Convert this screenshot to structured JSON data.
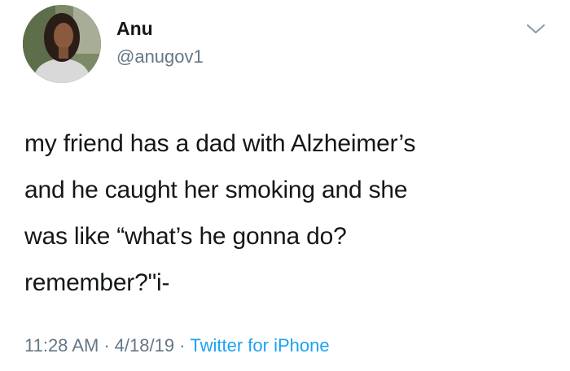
{
  "user": {
    "display_name": "Anu",
    "handle": "@anugov1"
  },
  "tweet": {
    "lines": [
      "my friend has a dad with Alzheimer’s",
      "and he caught her smoking and she",
      "was like “what’s he gonna do?",
      "remember?\"i-"
    ]
  },
  "meta": {
    "time": "11:28 AM",
    "separator": "·",
    "date": "4/18/19",
    "source": "Twitter for iPhone"
  },
  "icons": {
    "menu": "chevron-down-icon"
  },
  "colors": {
    "text": "#14171a",
    "secondary": "#657786",
    "link": "#1da1f2"
  }
}
